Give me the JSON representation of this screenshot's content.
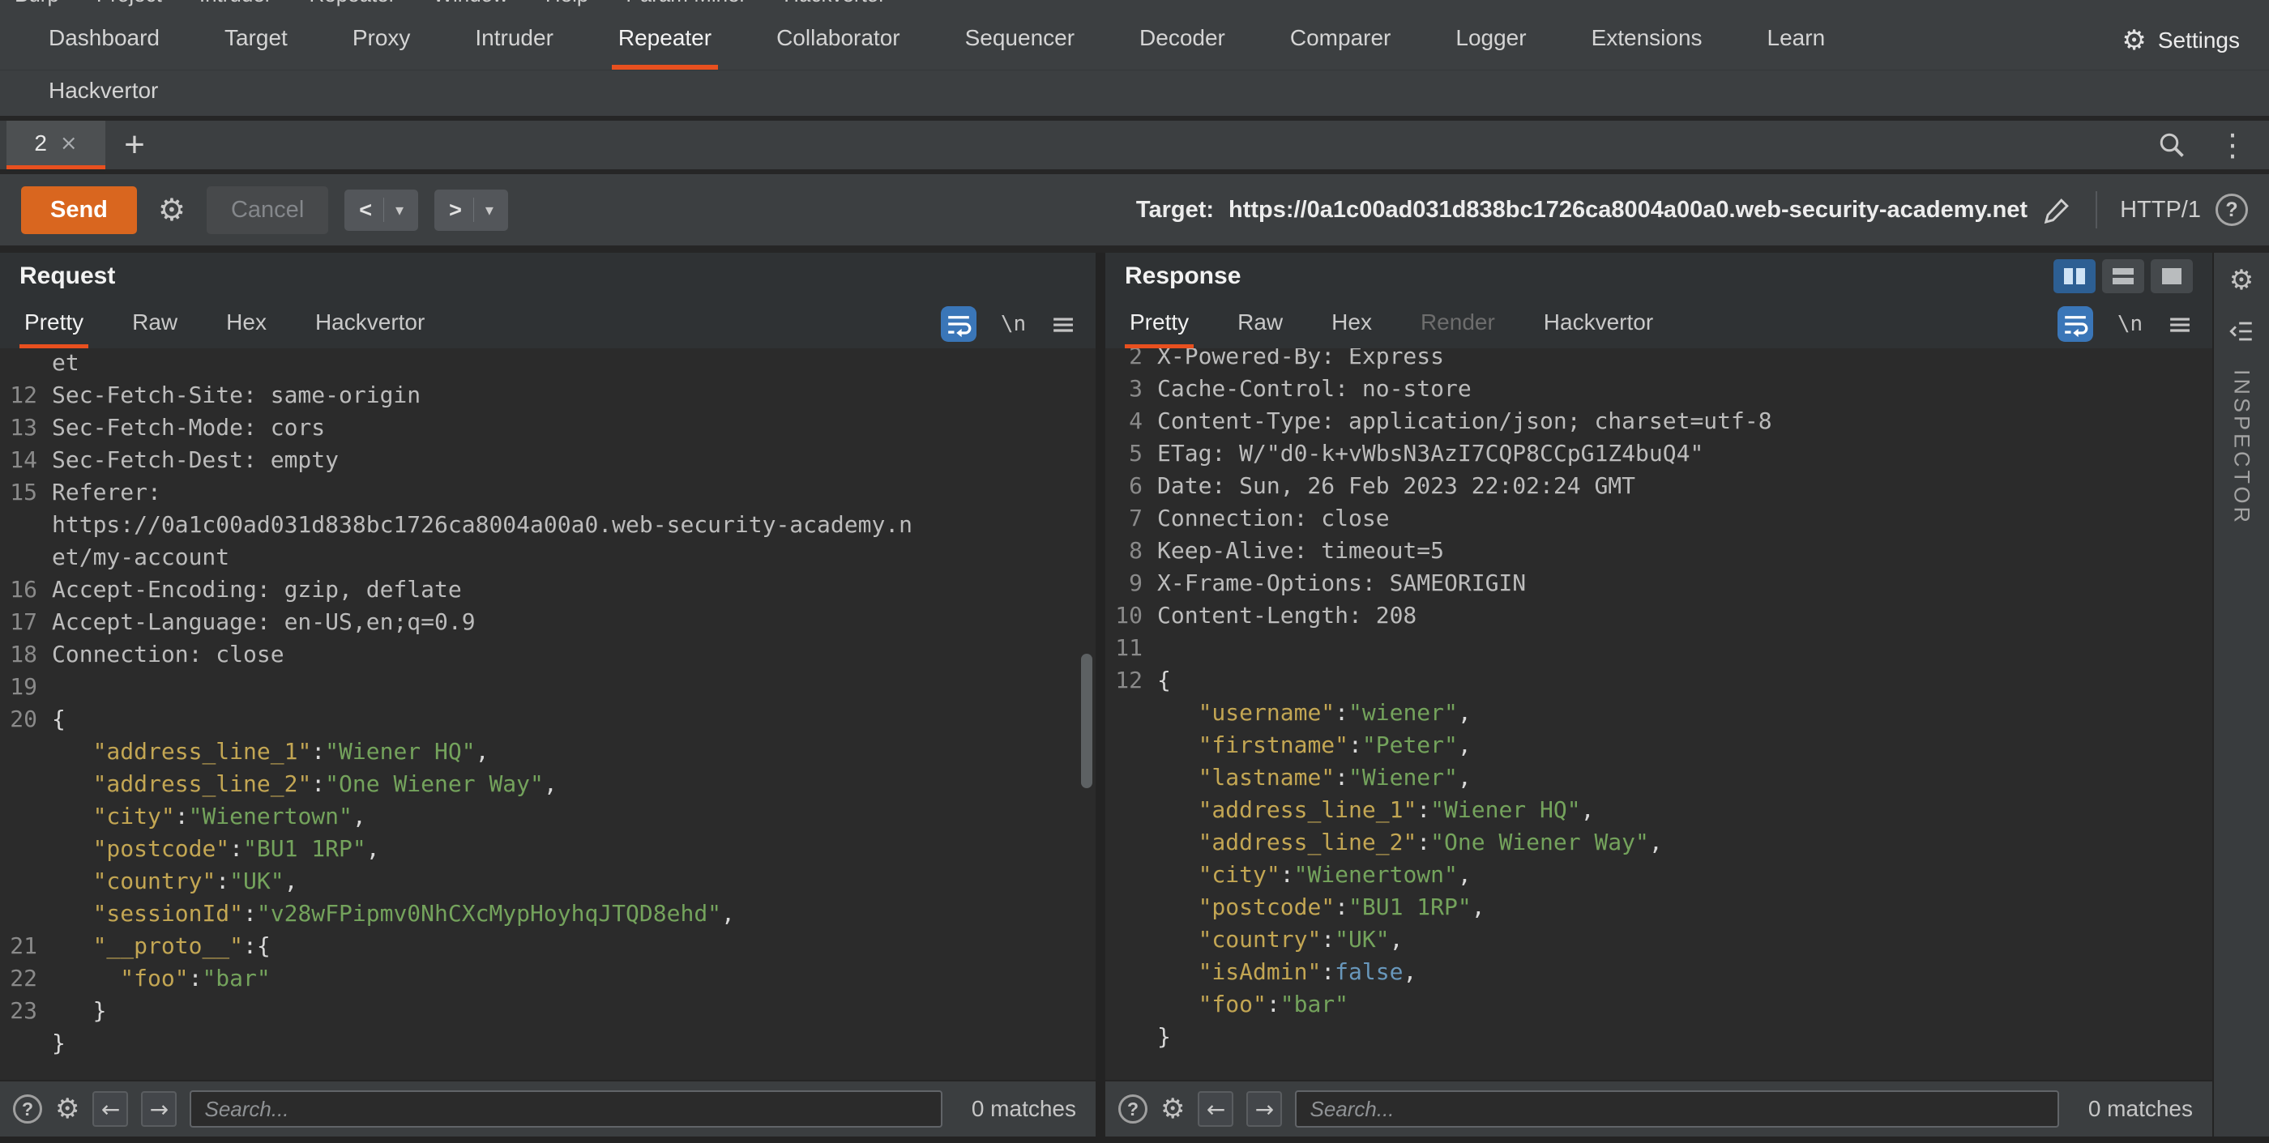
{
  "menubar": {
    "items": [
      "Burp",
      "Project",
      "Intruder",
      "Repeater",
      "Window",
      "Help",
      "Param Miner",
      "Hackvertor"
    ]
  },
  "main_tabs": {
    "row1": [
      "Dashboard",
      "Target",
      "Proxy",
      "Intruder",
      "Repeater",
      "Collaborator",
      "Sequencer",
      "Decoder",
      "Comparer",
      "Logger",
      "Extensions",
      "Learn"
    ],
    "selected": "Repeater",
    "row2": [
      "Hackvertor"
    ],
    "settings_label": "Settings"
  },
  "repeater_tabs": {
    "active_label": "2",
    "close_glyph": "×",
    "add_glyph": "+"
  },
  "toolbar": {
    "send_label": "Send",
    "cancel_label": "Cancel",
    "back_glyph": "<",
    "forward_glyph": ">",
    "target_label": "Target:",
    "target_url": "https://0a1c00ad031d838bc1726ca8004a00a0.web-security-academy.net",
    "http_version": "HTTP/1"
  },
  "icons": {
    "gear": "⚙",
    "kebab": "⋮",
    "caret": "▾",
    "hamburger": "≡",
    "newline": "\\n",
    "back_arrow": "←",
    "forward_arrow": "→",
    "help": "?"
  },
  "request_panel": {
    "title": "Request",
    "tabs": [
      "Pretty",
      "Raw",
      "Hex",
      "Hackvertor"
    ],
    "selected_tab": "Pretty",
    "disabled_tabs": [],
    "footer": {
      "search_placeholder": "Search...",
      "matches": "0 matches"
    },
    "lines": [
      {
        "n": "",
        "t": [
          [
            "p",
            "et"
          ]
        ]
      },
      {
        "n": "12",
        "t": [
          [
            "p",
            "Sec-Fetch-Site: same-origin"
          ]
        ]
      },
      {
        "n": "13",
        "t": [
          [
            "p",
            "Sec-Fetch-Mode: cors"
          ]
        ]
      },
      {
        "n": "14",
        "t": [
          [
            "p",
            "Sec-Fetch-Dest: empty"
          ]
        ]
      },
      {
        "n": "15",
        "t": [
          [
            "p",
            "Referer:"
          ]
        ]
      },
      {
        "n": "",
        "t": [
          [
            "p",
            "https://0a1c00ad031d838bc1726ca8004a00a0.web-security-academy.n"
          ]
        ]
      },
      {
        "n": "",
        "t": [
          [
            "p",
            "et/my-account"
          ]
        ]
      },
      {
        "n": "16",
        "t": [
          [
            "p",
            "Accept-Encoding: gzip, deflate"
          ]
        ]
      },
      {
        "n": "17",
        "t": [
          [
            "p",
            "Accept-Language: en-US,en;q=0.9"
          ]
        ]
      },
      {
        "n": "18",
        "t": [
          [
            "p",
            "Connection: close"
          ]
        ]
      },
      {
        "n": "19",
        "t": []
      },
      {
        "n": "20",
        "t": [
          [
            "w",
            "{"
          ]
        ]
      },
      {
        "n": "",
        "t": [
          [
            "w",
            "   "
          ],
          [
            "k",
            "\"address_line_1\""
          ],
          [
            "w",
            ":"
          ],
          [
            "s",
            "\"Wiener HQ\""
          ],
          [
            "w",
            ","
          ]
        ]
      },
      {
        "n": "",
        "t": [
          [
            "w",
            "   "
          ],
          [
            "k",
            "\"address_line_2\""
          ],
          [
            "w",
            ":"
          ],
          [
            "s",
            "\"One Wiener Way\""
          ],
          [
            "w",
            ","
          ]
        ]
      },
      {
        "n": "",
        "t": [
          [
            "w",
            "   "
          ],
          [
            "k",
            "\"city\""
          ],
          [
            "w",
            ":"
          ],
          [
            "s",
            "\"Wienertown\""
          ],
          [
            "w",
            ","
          ]
        ]
      },
      {
        "n": "",
        "t": [
          [
            "w",
            "   "
          ],
          [
            "k",
            "\"postcode\""
          ],
          [
            "w",
            ":"
          ],
          [
            "s",
            "\"BU1 1RP\""
          ],
          [
            "w",
            ","
          ]
        ]
      },
      {
        "n": "",
        "t": [
          [
            "w",
            "   "
          ],
          [
            "k",
            "\"country\""
          ],
          [
            "w",
            ":"
          ],
          [
            "s",
            "\"UK\""
          ],
          [
            "w",
            ","
          ]
        ]
      },
      {
        "n": "",
        "t": [
          [
            "w",
            "   "
          ],
          [
            "k",
            "\"sessionId\""
          ],
          [
            "w",
            ":"
          ],
          [
            "s",
            "\"v28wFPipmv0NhCXcMypHoyhqJTQD8ehd\""
          ],
          [
            "w",
            ","
          ]
        ]
      },
      {
        "n": "21",
        "t": [
          [
            "w",
            "   "
          ],
          [
            "k",
            "\"__proto__\""
          ],
          [
            "w",
            ":{"
          ]
        ]
      },
      {
        "n": "22",
        "t": [
          [
            "w",
            "     "
          ],
          [
            "k",
            "\"foo\""
          ],
          [
            "w",
            ":"
          ],
          [
            "s",
            "\"bar\""
          ]
        ]
      },
      {
        "n": "23",
        "t": [
          [
            "w",
            "   }"
          ]
        ]
      },
      {
        "n": "",
        "t": [
          [
            "w",
            "}"
          ]
        ]
      }
    ]
  },
  "response_panel": {
    "title": "Response",
    "tabs": [
      "Pretty",
      "Raw",
      "Hex",
      "Render",
      "Hackvertor"
    ],
    "selected_tab": "Pretty",
    "disabled_tabs": [
      "Render"
    ],
    "footer": {
      "search_placeholder": "Search...",
      "matches": "0 matches"
    },
    "lines": [
      {
        "n": "2",
        "t": [
          [
            "p",
            "X-Powered-By: Express"
          ]
        ]
      },
      {
        "n": "3",
        "t": [
          [
            "p",
            "Cache-Control: no-store"
          ]
        ]
      },
      {
        "n": "4",
        "t": [
          [
            "p",
            "Content-Type: application/json; charset=utf-8"
          ]
        ]
      },
      {
        "n": "5",
        "t": [
          [
            "p",
            "ETag: W/\"d0-k+vWbsN3AzI7CQP8CCpG1Z4buQ4\""
          ]
        ]
      },
      {
        "n": "6",
        "t": [
          [
            "p",
            "Date: Sun, 26 Feb 2023 22:02:24 GMT"
          ]
        ]
      },
      {
        "n": "7",
        "t": [
          [
            "p",
            "Connection: close"
          ]
        ]
      },
      {
        "n": "8",
        "t": [
          [
            "p",
            "Keep-Alive: timeout=5"
          ]
        ]
      },
      {
        "n": "9",
        "t": [
          [
            "p",
            "X-Frame-Options: SAMEORIGIN"
          ]
        ]
      },
      {
        "n": "10",
        "t": [
          [
            "p",
            "Content-Length: 208"
          ]
        ]
      },
      {
        "n": "11",
        "t": []
      },
      {
        "n": "12",
        "t": [
          [
            "w",
            "{"
          ]
        ]
      },
      {
        "n": "",
        "t": [
          [
            "w",
            "   "
          ],
          [
            "k",
            "\"username\""
          ],
          [
            "w",
            ":"
          ],
          [
            "s",
            "\"wiener\""
          ],
          [
            "w",
            ","
          ]
        ]
      },
      {
        "n": "",
        "t": [
          [
            "w",
            "   "
          ],
          [
            "k",
            "\"firstname\""
          ],
          [
            "w",
            ":"
          ],
          [
            "s",
            "\"Peter\""
          ],
          [
            "w",
            ","
          ]
        ]
      },
      {
        "n": "",
        "t": [
          [
            "w",
            "   "
          ],
          [
            "k",
            "\"lastname\""
          ],
          [
            "w",
            ":"
          ],
          [
            "s",
            "\"Wiener\""
          ],
          [
            "w",
            ","
          ]
        ]
      },
      {
        "n": "",
        "t": [
          [
            "w",
            "   "
          ],
          [
            "k",
            "\"address_line_1\""
          ],
          [
            "w",
            ":"
          ],
          [
            "s",
            "\"Wiener HQ\""
          ],
          [
            "w",
            ","
          ]
        ]
      },
      {
        "n": "",
        "t": [
          [
            "w",
            "   "
          ],
          [
            "k",
            "\"address_line_2\""
          ],
          [
            "w",
            ":"
          ],
          [
            "s",
            "\"One Wiener Way\""
          ],
          [
            "w",
            ","
          ]
        ]
      },
      {
        "n": "",
        "t": [
          [
            "w",
            "   "
          ],
          [
            "k",
            "\"city\""
          ],
          [
            "w",
            ":"
          ],
          [
            "s",
            "\"Wienertown\""
          ],
          [
            "w",
            ","
          ]
        ]
      },
      {
        "n": "",
        "t": [
          [
            "w",
            "   "
          ],
          [
            "k",
            "\"postcode\""
          ],
          [
            "w",
            ":"
          ],
          [
            "s",
            "\"BU1 1RP\""
          ],
          [
            "w",
            ","
          ]
        ]
      },
      {
        "n": "",
        "t": [
          [
            "w",
            "   "
          ],
          [
            "k",
            "\"country\""
          ],
          [
            "w",
            ":"
          ],
          [
            "s",
            "\"UK\""
          ],
          [
            "w",
            ","
          ]
        ]
      },
      {
        "n": "",
        "t": [
          [
            "w",
            "   "
          ],
          [
            "k",
            "\"isAdmin\""
          ],
          [
            "w",
            ":"
          ],
          [
            "b",
            "false"
          ],
          [
            "w",
            ","
          ]
        ]
      },
      {
        "n": "",
        "t": [
          [
            "w",
            "   "
          ],
          [
            "k",
            "\"foo\""
          ],
          [
            "w",
            ":"
          ],
          [
            "s",
            "\"bar\""
          ]
        ]
      },
      {
        "n": "",
        "t": [
          [
            "w",
            "}"
          ]
        ]
      }
    ]
  },
  "inspector": {
    "label": "INSPECTOR"
  },
  "colors": {
    "accent_orange": "#e8501f",
    "send_button": "#d9661f",
    "accent_blue": "#3a76b8",
    "json_key": "#c3a653",
    "json_string": "#74a35c",
    "json_bool": "#6897bb",
    "editor_bg": "#2b2b2b",
    "chrome_bg": "#3c3f41"
  }
}
